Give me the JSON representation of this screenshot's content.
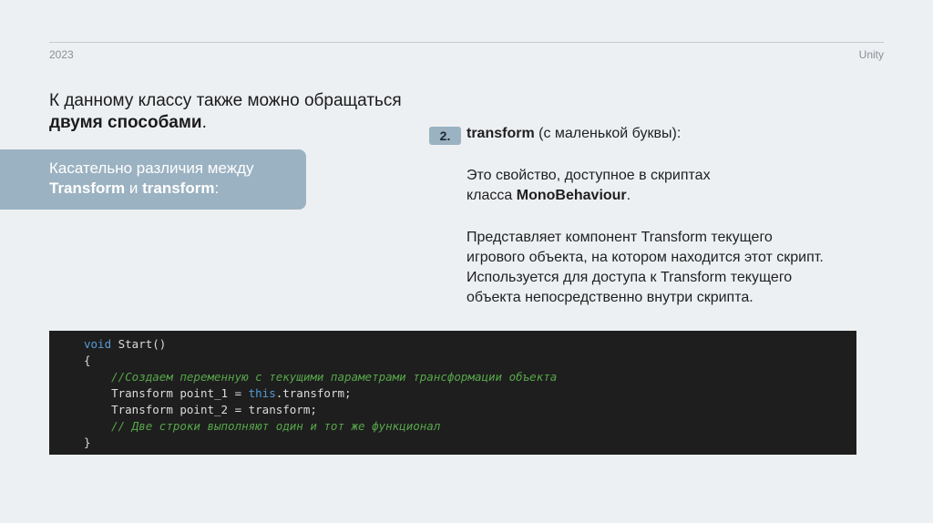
{
  "header": {
    "year": "2023",
    "brand": "Unity"
  },
  "intro": {
    "text": "К данному классу также можно обращаться ",
    "bold": "двумя способами",
    "end": "."
  },
  "note": {
    "line1": "Касательно различия между",
    "bold1": "Transform",
    "mid": " и ",
    "bold2": "transform",
    "end": ":"
  },
  "item": {
    "number": "2.",
    "title_bold": "transform",
    "title_rest": " (с маленькой буквы):",
    "p1_line1": "Это свойство, доступное в скриптах",
    "p1_prefix": "класса ",
    "p1_bold": "MonoBehaviour",
    "p1_end": ".",
    "p2_line1": "Представляет компонент Transform текущего",
    "p2_line2": "игрового объекта, на котором находится этот скрипт.",
    "p2_line3": "Используется для доступа к Transform текущего",
    "p2_line4": "объекта непосредственно внутри скрипта."
  },
  "code": {
    "l1_kw": "void",
    "l1_rest": " Start()",
    "l2": "{",
    "l3_comment": "//Создаем переменную с текущими параметрами трансформации объекта",
    "l4_pre": "Transform point_1 = ",
    "l4_kw": "this",
    "l4_post": ".transform;",
    "l5": "Transform point_2 = transform;",
    "l6_comment": "// Две строки выполняют один и тот же функционал",
    "l7": "}"
  }
}
